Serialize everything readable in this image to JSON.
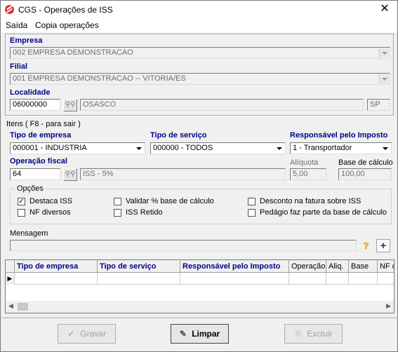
{
  "window": {
    "title": "CGS - Operações de ISS",
    "close_glyph": "✕"
  },
  "menu": {
    "saida": "Saída",
    "copia": "Copia operações"
  },
  "empresa": {
    "label": "Empresa",
    "value": "002 EMPRESA DEMONSTRACAO"
  },
  "filial": {
    "label": "Filial",
    "value": "001 EMPRESA DEMONSTRACAO -- VITORIA/ES"
  },
  "localidade": {
    "label": "Localidade",
    "code": "06000000",
    "name": "OSASCO",
    "uf": "SP"
  },
  "itens_caption": "Itens ( F8 - para sair )",
  "tipo_empresa": {
    "label": "Tipo de empresa",
    "value": "000001 - INDUSTRIA"
  },
  "tipo_servico": {
    "label": "Tipo de serviço",
    "value": "000000 - TODOS"
  },
  "responsavel": {
    "label": "Responsável pelo Imposto",
    "value": "1 - Transportador"
  },
  "operacao": {
    "label": "Operação fiscal",
    "code": "64",
    "name": "ISS - 5%"
  },
  "aliquota": {
    "label": "Alíquota",
    "value": "5,00"
  },
  "base_calculo": {
    "label": "Base de cálculo",
    "value": "100,00"
  },
  "opcoes": {
    "label": "Opções",
    "destaca_iss": {
      "label": "Destaca ISS",
      "checked": true
    },
    "nf_diversos": {
      "label": "NF diversos",
      "checked": false
    },
    "validar_base": {
      "label": "Validar % base de cálculo",
      "checked": false
    },
    "iss_retido": {
      "label": "ISS Retido",
      "checked": false
    },
    "desconto_fatura": {
      "label": "Desconto na fatura sobre ISS",
      "checked": false
    },
    "pedagio": {
      "label": "Pedágio faz parte da base de cálculo",
      "checked": false
    }
  },
  "mensagem": {
    "label": "Mensagem",
    "value": ""
  },
  "grid": {
    "columns": [
      "Tipo de empresa",
      "Tipo de serviço",
      "Responsável pelo Imposto",
      "Operação",
      "Aliq.",
      "Base",
      "NF d"
    ]
  },
  "buttons": {
    "gravar": "Gravar",
    "limpar": "Limpar",
    "excluir": "Excluir"
  },
  "icons": {
    "search": "binoculars-icon",
    "help": "question-icon",
    "add": "plus-icon"
  },
  "colors": {
    "label_blue": "#00008b",
    "help_yellow": "#f0c000",
    "add_blue": "#0a3aa8"
  }
}
